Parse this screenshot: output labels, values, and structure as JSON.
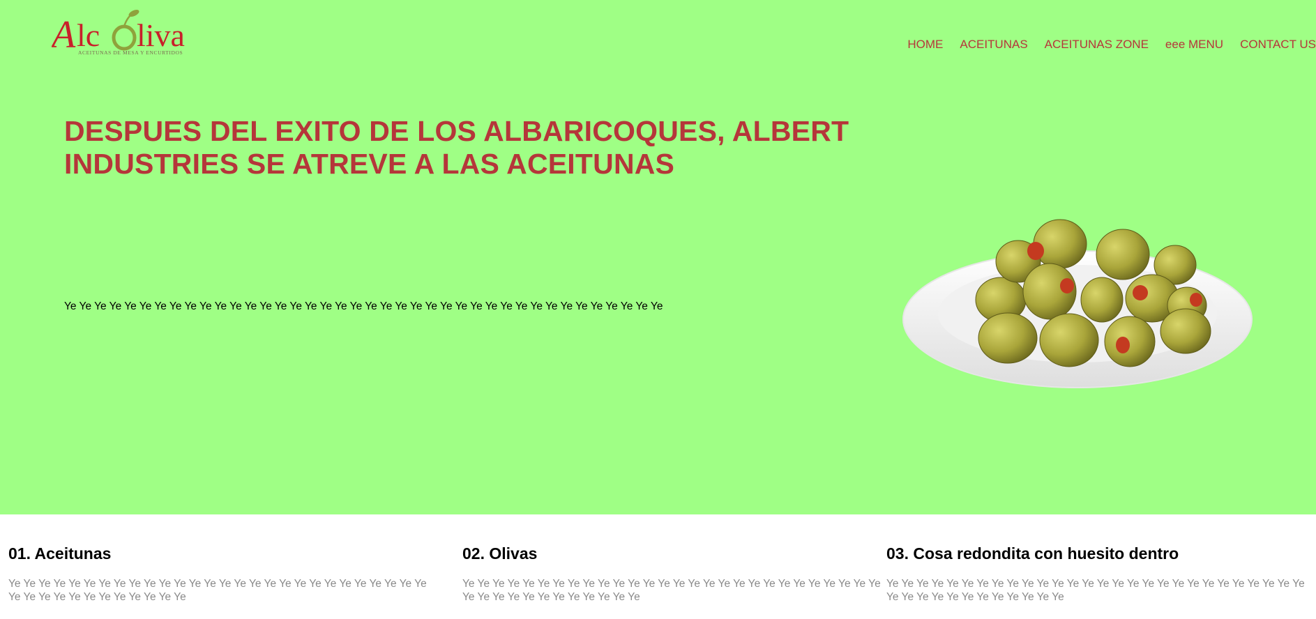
{
  "header": {
    "logo": {
      "name": "Alcoliva",
      "tagline": "Aceitunas de Mesa y Encurtidos"
    },
    "nav": [
      {
        "label": "HOME"
      },
      {
        "label": "ACEITUNAS"
      },
      {
        "label": "ACEITUNAS ZONE"
      },
      {
        "label": "eee MENU"
      },
      {
        "label": "CONTACT US"
      }
    ]
  },
  "hero": {
    "headline_line1": "DESPUES DEL EXITO DE LOS ALBARICOQUES, ALBERT",
    "headline_line2": "INDUSTRIES SE ATREVE A LAS ACEITUNAS",
    "text": "Ye Ye Ye Ye Ye Ye Ye Ye Ye Ye Ye Ye Ye Ye Ye Ye Ye Ye Ye Ye Ye Ye Ye Ye Ye Ye Ye Ye Ye Ye Ye Ye Ye Ye Ye Ye Ye Ye Ye Ye",
    "image_icon": "olive-bowl-image"
  },
  "features": [
    {
      "title": "01. Aceitunas",
      "text": "Ye Ye Ye Ye Ye Ye Ye Ye Ye Ye Ye Ye Ye Ye Ye Ye Ye Ye Ye Ye Ye Ye Ye Ye Ye Ye Ye Ye Ye Ye Ye Ye Ye Ye Ye Ye Ye Ye Ye Ye"
    },
    {
      "title": "02. Olivas",
      "text": "Ye Ye Ye Ye Ye Ye Ye Ye Ye Ye Ye Ye Ye Ye Ye Ye Ye Ye Ye Ye Ye Ye Ye Ye Ye Ye Ye Ye Ye Ye Ye Ye Ye Ye Ye Ye Ye Ye Ye Ye"
    },
    {
      "title": "03. Cosa redondita con huesito dentro",
      "text": "Ye Ye Ye Ye Ye Ye Ye Ye Ye Ye Ye Ye Ye Ye Ye Ye Ye Ye Ye Ye Ye Ye Ye Ye Ye Ye Ye Ye Ye Ye Ye Ye Ye Ye Ye Ye Ye Ye Ye Ye"
    }
  ],
  "colors": {
    "hero_background": "#9fff85",
    "accent_red": "#b5363a",
    "olive_green": "#8fa23c",
    "muted_text": "#8a8a8a"
  }
}
